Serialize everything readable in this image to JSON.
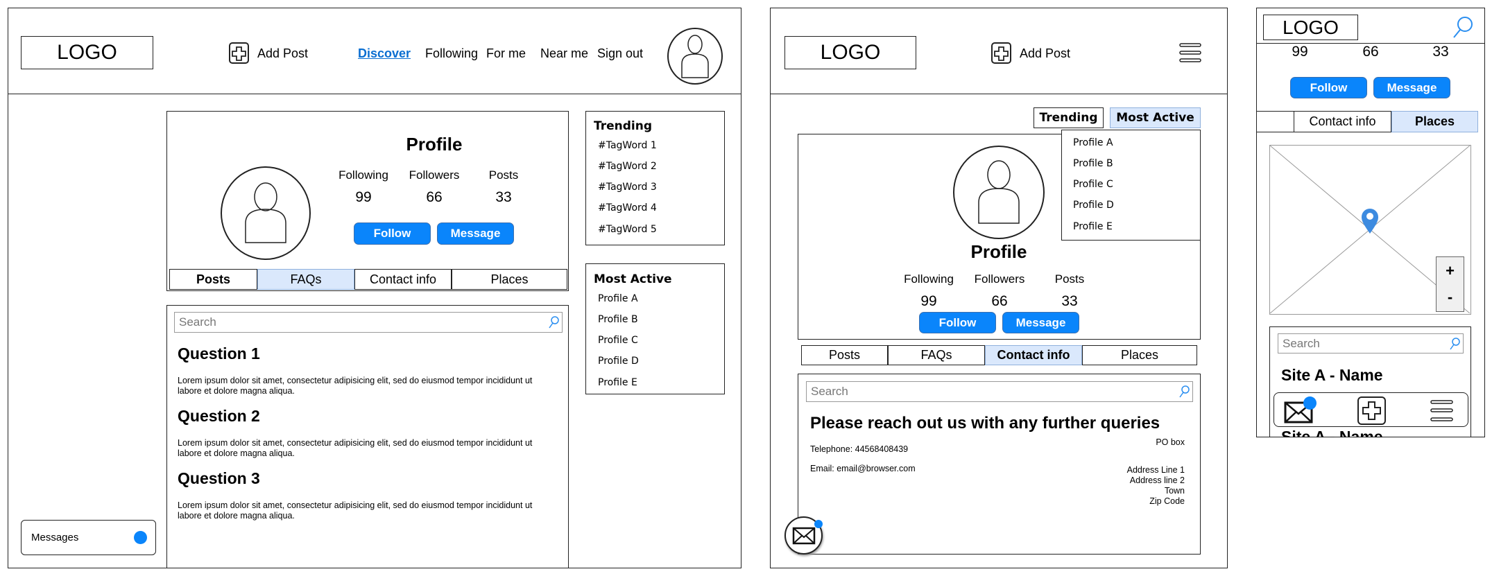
{
  "desktop": {
    "logo": "LOGO",
    "add_post": "Add Post",
    "nav": [
      "Discover",
      "Following",
      "For me",
      "Near me",
      "Sign out"
    ],
    "profile": {
      "title": "Profile",
      "stats_labels": [
        "Following",
        "Followers",
        "Posts"
      ],
      "stats_values": [
        "99",
        "66",
        "33"
      ],
      "follow": "Follow",
      "message": "Message"
    },
    "tabs": [
      "Posts",
      "FAQs",
      "Contact info",
      "Places"
    ],
    "search_placeholder": "Search",
    "faqs": [
      {
        "q": "Question 1",
        "a": "Lorem ipsum dolor sit amet, consectetur adipisicing elit, sed do eiusmod tempor incididunt ut labore et dolore magna aliqua."
      },
      {
        "q": "Question 2",
        "a": "Lorem ipsum dolor sit amet, consectetur adipisicing elit, sed do eiusmod tempor incididunt ut labore et dolore magna aliqua."
      },
      {
        "q": "Question 3",
        "a": "Lorem ipsum dolor sit amet, consectetur adipisicing elit, sed do eiusmod tempor incididunt ut labore et dolore magna aliqua."
      }
    ],
    "trending": {
      "title": "Trending",
      "items": [
        "#TagWord 1",
        "#TagWord 2",
        "#TagWord 3",
        "#TagWord 4",
        "#TagWord 5"
      ]
    },
    "most_active": {
      "title": "Most Active",
      "items": [
        "Profile A",
        "Profile B",
        "Profile C",
        "Profile D",
        "Profile E"
      ]
    },
    "messages": "Messages"
  },
  "tablet": {
    "logo": "LOGO",
    "add_post": "Add Post",
    "side_tabs": [
      "Trending",
      "Most Active"
    ],
    "dropdown": [
      "Profile A",
      "Profile B",
      "Profile C",
      "Profile D",
      "Profile E"
    ],
    "profile": {
      "title": "Profile",
      "stats_labels": [
        "Following",
        "Followers",
        "Posts"
      ],
      "stats_values": [
        "99",
        "66",
        "33"
      ],
      "follow": "Follow",
      "message": "Message"
    },
    "tabs": [
      "Posts",
      "FAQs",
      "Contact info",
      "Places"
    ],
    "search_placeholder": "Search",
    "contact": {
      "heading": "Please reach out us with any further queries",
      "telephone": "Telephone: 44568408439",
      "email": "Email: email@browser.com",
      "po_box": "PO box",
      "address": [
        "Address Line 1",
        "Address line 2",
        "Town",
        "Zip Code"
      ]
    }
  },
  "mobile": {
    "logo": "LOGO",
    "stats_values": [
      "99",
      "66",
      "33"
    ],
    "follow": "Follow",
    "message": "Message",
    "tabs": [
      "",
      "Contact info",
      "Places"
    ],
    "zoom_in": "+",
    "zoom_out": "-",
    "search_placeholder": "Search",
    "sites": [
      "Site A - Name",
      "Site A - Name"
    ]
  },
  "colors": {
    "accent": "#0a85fb",
    "active_tab": "#dae8fc",
    "pin": "#3d8be0"
  }
}
